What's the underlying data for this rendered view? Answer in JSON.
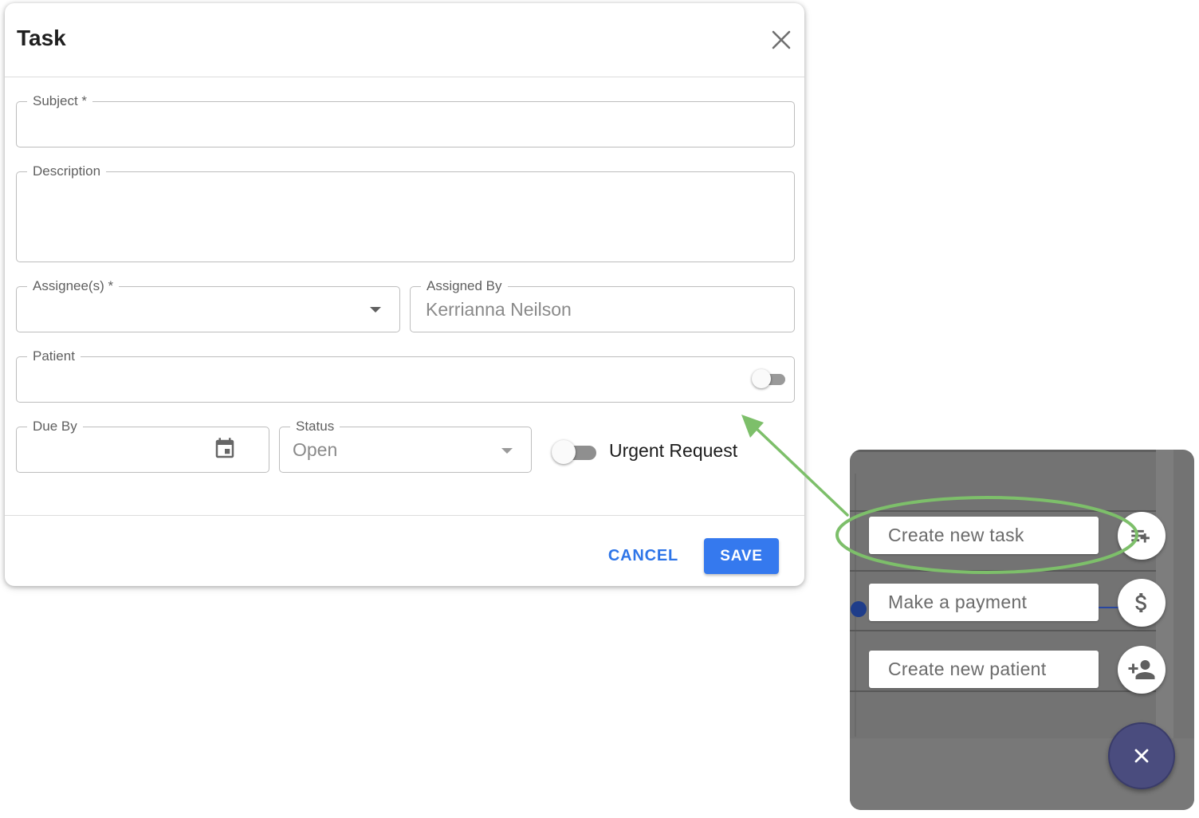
{
  "dialog": {
    "title": "Task",
    "fields": {
      "subject": {
        "label": "Subject *",
        "value": ""
      },
      "description": {
        "label": "Description",
        "value": ""
      },
      "assignees": {
        "label": "Assignee(s) *",
        "value": ""
      },
      "assigned_by": {
        "label": "Assigned By",
        "value": "Kerrianna Neilson"
      },
      "patient": {
        "label": "Patient",
        "value": "",
        "toggle_on": false
      },
      "due_by": {
        "label": "Due By",
        "value": ""
      },
      "status": {
        "label": "Status",
        "value": "Open"
      }
    },
    "urgent_request": {
      "label": "Urgent Request",
      "on": false
    },
    "cancel_label": "CANCEL",
    "save_label": "SAVE"
  },
  "speed_dial": {
    "actions": [
      {
        "label": "Create new task",
        "icon": "playlist-add-icon"
      },
      {
        "label": "Make a payment",
        "icon": "dollar-icon"
      },
      {
        "label": "Create new patient",
        "icon": "person-add-icon"
      }
    ],
    "close_icon": "close-icon"
  },
  "colors": {
    "accent": "#3579ee",
    "annotation": "#7dbf6a",
    "fab": "#4a4c7e",
    "panel": "#737373"
  }
}
